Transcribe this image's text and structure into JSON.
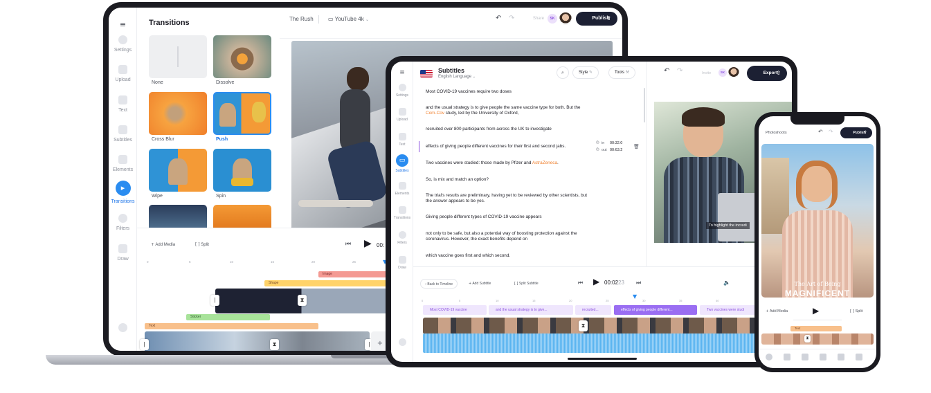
{
  "laptop": {
    "sidebar": [
      {
        "label": "Settings",
        "icon": "settings-icon"
      },
      {
        "label": "Upload",
        "icon": "upload-icon"
      },
      {
        "label": "Text",
        "icon": "text-icon"
      },
      {
        "label": "Subtitles",
        "icon": "subtitles-icon"
      },
      {
        "label": "Elements",
        "icon": "elements-icon"
      },
      {
        "label": "Transitions",
        "icon": "transitions-icon",
        "active": true
      },
      {
        "label": "Filters",
        "icon": "filters-icon"
      },
      {
        "label": "Draw",
        "icon": "draw-icon"
      }
    ],
    "panel": {
      "title": "Transitions",
      "tiles": [
        {
          "label": "None"
        },
        {
          "label": "Dissolve"
        },
        {
          "label": "Cross Blur"
        },
        {
          "label": "Push",
          "selected": true
        },
        {
          "label": "Wipe"
        },
        {
          "label": "Spin"
        }
      ]
    },
    "topbar": {
      "project": "The Rush",
      "format": "YouTube 4k",
      "share": "Share",
      "avatar_initials": "SK",
      "publish": "Publish"
    },
    "timeline": {
      "add_media": "Add Media",
      "split": "Split",
      "time": "00:",
      "ruler": [
        "0",
        "5",
        "10",
        "15",
        "20",
        "25"
      ],
      "tracks": [
        "Image",
        "Shape",
        "Sticker",
        "Text"
      ]
    }
  },
  "tablet": {
    "sidebar": [
      {
        "label": "Settings"
      },
      {
        "label": "Upload"
      },
      {
        "label": "Text"
      },
      {
        "label": "Subtitles",
        "active": true
      },
      {
        "label": "Elements"
      },
      {
        "label": "Transitions"
      },
      {
        "label": "Filters"
      },
      {
        "label": "Draw"
      }
    ],
    "header": {
      "title": "Subtitles",
      "language": "English Language",
      "style": "Style",
      "tools": "Tools",
      "invite": "Invite",
      "avatar_initials": "SK",
      "export": "Export"
    },
    "subtitles": [
      {
        "parts": [
          "Most COVID-19 vaccines require two doses"
        ]
      },
      {
        "parts": [
          "and the usual strategy is to give people the same vaccine type for both. But the ",
          "Com-Cov",
          " study, led by the University of Oxford,"
        ]
      },
      {
        "parts": [
          "recruited over 800 participants from across the UK to investigate"
        ]
      },
      {
        "parts": [
          "effects of giving people different vaccines for their first and second jabs."
        ],
        "active": true
      },
      {
        "parts": [
          "Two vaccines were studied: those made by Pfizer and ",
          "AstraZeneca",
          "."
        ]
      },
      {
        "parts": [
          "So, is mix and match an option?"
        ]
      },
      {
        "parts": [
          "The trial's results are preliminary, having yet to be reviewed by other scientists, but the answer appears to be yes."
        ]
      },
      {
        "parts": [
          "Giving people different types of COVID-19 vaccine appears"
        ]
      },
      {
        "parts": [
          "not only to be safe, but also a potential way of boosting protection against the coronavirus. However, the exact benefits depend on"
        ]
      },
      {
        "parts": [
          "which vaccine goes first and which second."
        ]
      }
    ],
    "active_times": {
      "in_label": "in",
      "in": "00:32.0",
      "out_label": "out",
      "out": "00:63.2"
    },
    "caption": "To highlight the incredi",
    "timeline": {
      "back": "Back to Timeline",
      "add_subtitle": "Add Subtitle",
      "split_subtitle": "Split Subtitle",
      "time_main": "00:02",
      "time_frac": "23",
      "ruler": [
        "0",
        "5",
        "10",
        "15",
        "20",
        "25",
        "30",
        "35",
        "40"
      ],
      "chips": [
        {
          "label": "Most COVID-19 vaccine"
        },
        {
          "label": "and the usual strategy is to give..."
        },
        {
          "label": "recruited..."
        },
        {
          "label": "effects of giving people different...",
          "active": true
        },
        {
          "label": "Two vaccines were studi"
        }
      ]
    }
  },
  "phone": {
    "title": "Photoshoots",
    "publish": "Publish",
    "art_line1": "The Art of Being",
    "art_line2": "MAGNIFICENT",
    "add_media": "Add Media",
    "split": "Split",
    "track": "Text"
  }
}
